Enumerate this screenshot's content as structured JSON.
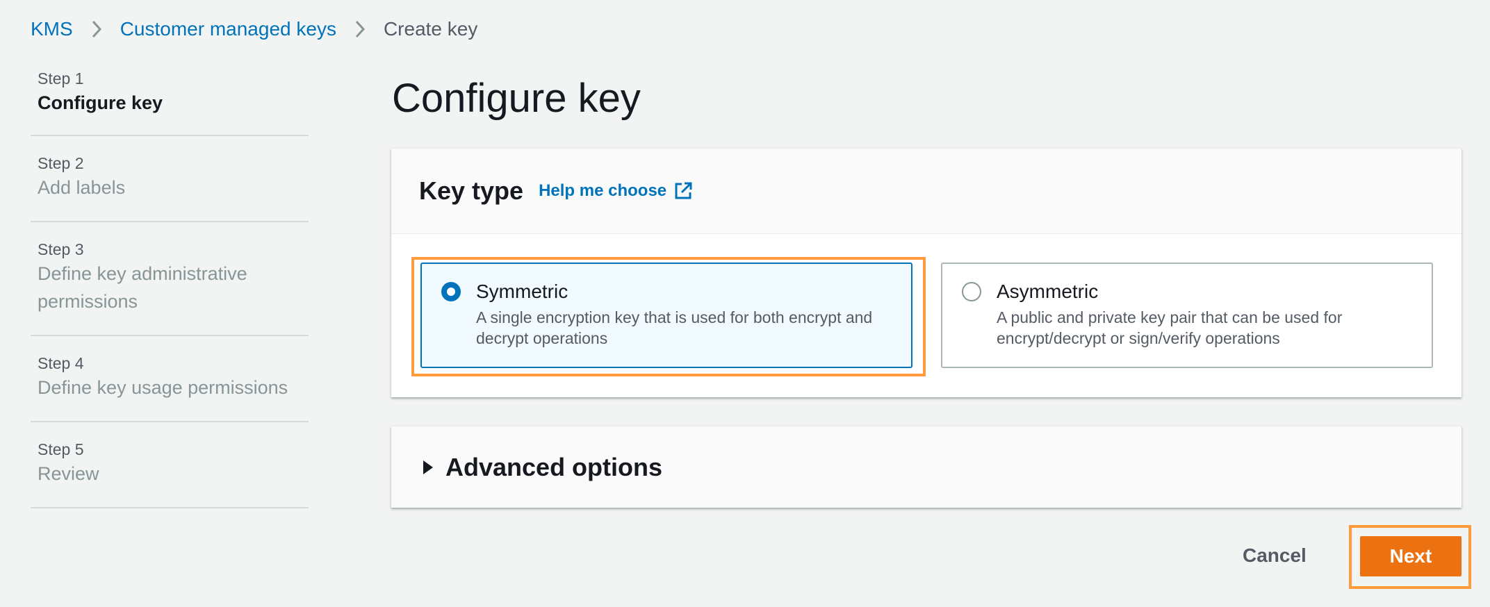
{
  "breadcrumb": {
    "items": [
      {
        "label": "KMS"
      },
      {
        "label": "Customer managed keys"
      },
      {
        "label": "Create key"
      }
    ]
  },
  "steps": [
    {
      "number": "Step 1",
      "label": "Configure key",
      "active": true
    },
    {
      "number": "Step 2",
      "label": "Add labels",
      "active": false
    },
    {
      "number": "Step 3",
      "label": "Define key administrative permissions",
      "active": false
    },
    {
      "number": "Step 4",
      "label": "Define key usage permissions",
      "active": false
    },
    {
      "number": "Step 5",
      "label": "Review",
      "active": false
    }
  ],
  "page_title": "Configure key",
  "key_type_panel": {
    "title": "Key type",
    "help_link": "Help me choose",
    "options": [
      {
        "title": "Symmetric",
        "description": "A single encryption key that is used for both encrypt and decrypt operations",
        "selected": true
      },
      {
        "title": "Asymmetric",
        "description": "A public and private key pair that can be used for encrypt/decrypt or sign/verify operations",
        "selected": false
      }
    ]
  },
  "advanced_options": {
    "label": "Advanced options"
  },
  "actions": {
    "cancel": "Cancel",
    "next": "Next"
  },
  "colors": {
    "link": "#0073bb",
    "primary_button": "#ec7211",
    "highlight": "#ff9b3b",
    "selected_tile_bg": "#f1faff"
  }
}
